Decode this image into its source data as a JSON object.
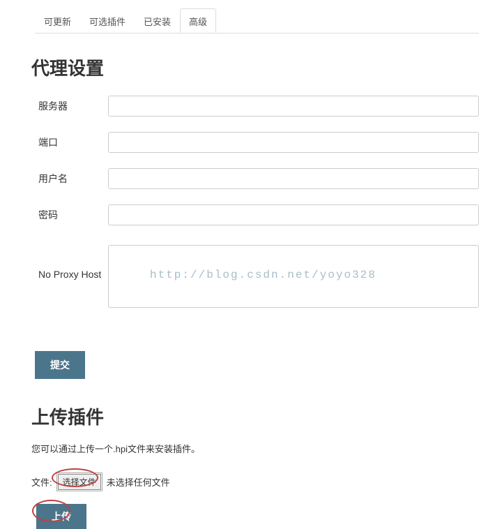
{
  "tabs": {
    "updatable": "可更新",
    "available": "可选插件",
    "installed": "已安装",
    "advanced": "高级"
  },
  "proxy": {
    "title": "代理设置",
    "server_label": "服务器",
    "port_label": "端口",
    "username_label": "用户名",
    "password_label": "密码",
    "noproxy_label": "No Proxy Host",
    "submit_label": "提交"
  },
  "upload": {
    "title": "上传插件",
    "desc": "您可以通过上传一个.hpi文件来安装插件。",
    "file_label": "文件:",
    "choose_button": "选择文件",
    "file_status": "未选择任何文件",
    "upload_button": "上传"
  },
  "watermark": "http://blog.csdn.net/yoyo328"
}
